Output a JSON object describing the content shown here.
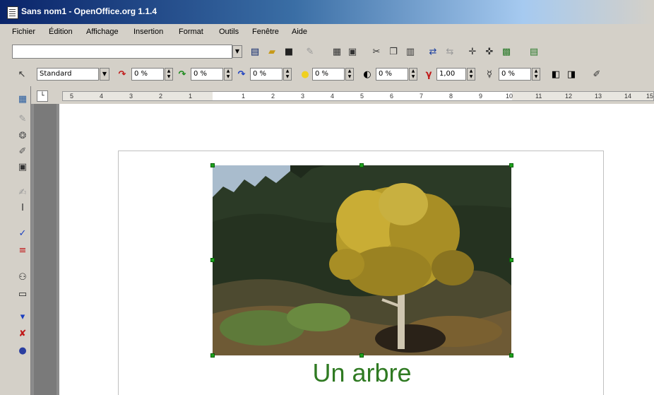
{
  "window": {
    "title": "Sans nom1 - OpenOffice.org 1.1.4"
  },
  "menu": [
    "Fichier",
    "Édition",
    "Affichage",
    "Insertion",
    "Format",
    "Outils",
    "Fenêtre",
    "Aide"
  ],
  "toolbar2": {
    "style_value": "Standard",
    "red_value": "0 %",
    "green_value": "0 %",
    "blue_value": "0 %",
    "brightness_value": "0 %",
    "contrast_value": "0 %",
    "gamma_value": "1,00",
    "transparency_value": "0 %"
  },
  "ruler": {
    "labels": [
      "5",
      "4",
      "3",
      "2",
      "1",
      "1",
      "2",
      "3",
      "4",
      "5",
      "6",
      "7",
      "8",
      "9",
      "10",
      "11",
      "12",
      "13",
      "14",
      "15"
    ]
  },
  "document": {
    "caption": "Un arbre"
  },
  "colors": {
    "caption": "#2f7a22",
    "handle": "#1ea31e",
    "titlebar": "#0a246a"
  }
}
